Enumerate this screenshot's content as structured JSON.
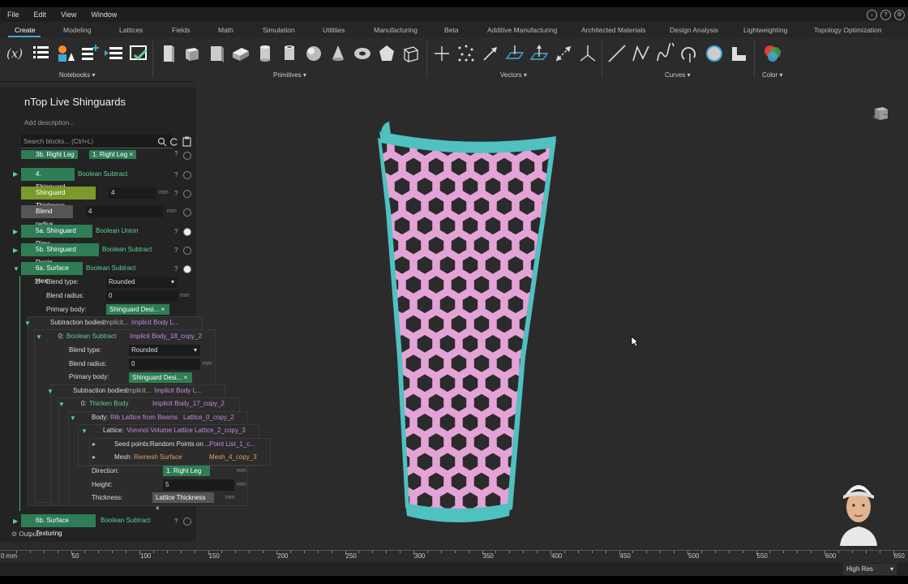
{
  "menu": {
    "items": [
      "File",
      "Edit",
      "View",
      "Window"
    ]
  },
  "tabs": [
    "Create",
    "Modeling",
    "Lattices",
    "Fields",
    "Math",
    "Simulation",
    "Utilities",
    "Manufacturing",
    "Beta",
    "Additive Manufacturing",
    "Architected Materials",
    "Design Analysis",
    "Lightweighting",
    "Topology Optimization"
  ],
  "ribbon": {
    "groups": [
      "Notebooks",
      "Primitives",
      "Vectors",
      "Curves",
      "Color"
    ],
    "math_label": "(x)"
  },
  "panel": {
    "title": "nTop Live Shinguards",
    "description": "Add description...",
    "search_placeholder": "Search blocks... (Ctrl+L)",
    "rows": {
      "r3b": {
        "name": "3b. Right Leg",
        "chip": "1. Right Leg"
      },
      "r4": {
        "name": "4. Shinguard",
        "type": "Boolean Subtract"
      },
      "thick": {
        "name": "Shinguard Thickness",
        "value": "4",
        "unit": "mm"
      },
      "blend": {
        "name": "Blend radius",
        "value": "4",
        "unit": "mm"
      },
      "r5a": {
        "name": "5a. Shinguard Rims",
        "type": "Boolean Union"
      },
      "r5b": {
        "name": "5b. Shinguard Desig...",
        "type": "Boolean Subtract"
      },
      "r6a": {
        "name": "6a. Surface Hex",
        "type": "Boolean Subtract"
      },
      "blend_type_label": "Blend type:",
      "blend_type_value": "Rounded",
      "blend_radius_label": "Blend radius:",
      "blend_radius_value": "0",
      "unit_mm": "mm",
      "primary_label": "Primary body:",
      "primary_value": "Shinguard Desi...",
      "sub_label": "Subtraction bodies:",
      "sub_value": "Implicit...",
      "sub_type": "Implicit Body L...",
      "n0_index": "0:",
      "n0_type": "Boolean Subtract",
      "n0_ref": "Implicit Body_18_copy_2",
      "n1_type": "Thicken Body",
      "n1_ref": "Implicit Body_17_copy_2",
      "body_label": "Body:",
      "body_value": "Rib Lattice from Beams",
      "body_ref": "Lattice_0_copy_2",
      "lattice_label": "Lattice:",
      "lattice_value": "Voronoi Volume Lattice",
      "lattice_ref": "Lattice_2_copy_3",
      "seed_label": "Seed points:",
      "seed_value": "Random Points on ...",
      "seed_ref": "Point List_1_c...",
      "mesh_label": "Mesh:",
      "mesh_value": "Remesh Surface",
      "mesh_ref": "Mesh_4_copy_3",
      "dir_label": "Direction:",
      "dir_value": "1. Right Leg",
      "height_label": "Height:",
      "height_value": "5",
      "thickness_label": "Thickness:",
      "thickness_value": "Lattice Thickness",
      "r6b": {
        "name": "6b. Surface Texturing",
        "type": "Boolean Subtract"
      },
      "output_label": "Output:"
    }
  },
  "ruler": {
    "unit_label": "0 mm",
    "ticks": [
      "50",
      "100",
      "150",
      "200",
      "250",
      "300",
      "350",
      "400",
      "450",
      "500",
      "550",
      "600",
      "650"
    ]
  },
  "status": {
    "render_mode": "High Res"
  },
  "viewcube": {
    "label": "Top"
  },
  "colors": {
    "accent": "#3fa9d6",
    "block_green": "#2e7d55",
    "shin_pink": "#e4a3d6",
    "shin_teal": "#4fc1c0"
  }
}
